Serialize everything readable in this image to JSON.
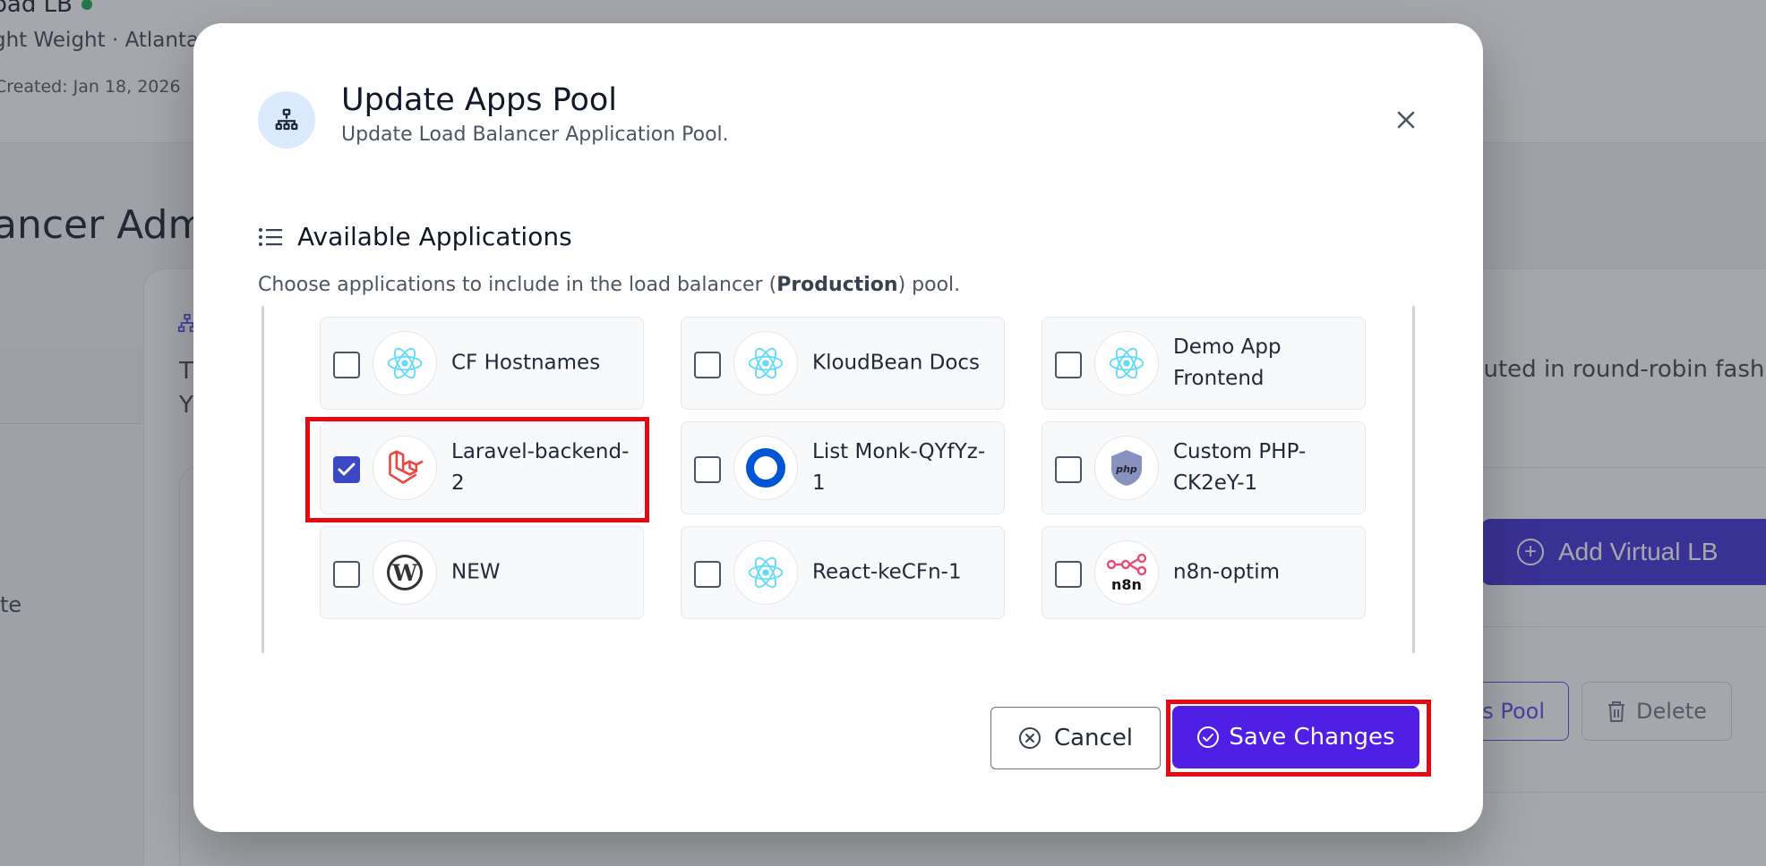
{
  "background": {
    "lb_name": "oad LB",
    "lb_meta": "ght Weight · Atlanta",
    "created": "Created: Jan 18, 2026",
    "page_title": "ancer Adm",
    "card_text_t": "T",
    "card_text_y": "Y",
    "side_text": "te",
    "round_robin_text": "buted in round-robin fash",
    "add_virtual_lb": "Add Virtual LB",
    "apps_pool_button": "s Pool",
    "delete_button": "Delete"
  },
  "modal": {
    "title": "Update Apps Pool",
    "subtitle": "Update Load Balancer Application Pool.",
    "section_title": "Available Applications",
    "desc_prefix": "Choose applications to include in the load balancer (",
    "desc_env": "Production",
    "desc_suffix": ") pool.",
    "cancel_label": "Cancel",
    "save_label": "Save Changes"
  },
  "apps": [
    {
      "name": "CF Hostnames",
      "icon": "react-icon",
      "checked": false
    },
    {
      "name": "KloudBean Docs",
      "icon": "react-icon",
      "checked": false
    },
    {
      "name": "Demo App Frontend",
      "icon": "react-icon",
      "checked": false
    },
    {
      "name": "Laravel-backend-2",
      "icon": "laravel-icon",
      "checked": true
    },
    {
      "name": "List Monk-QYfYz-1",
      "icon": "listmonk-icon",
      "checked": false
    },
    {
      "name": "Custom PHP-CK2eY-1",
      "icon": "php-icon",
      "checked": false
    },
    {
      "name": "NEW",
      "icon": "wordpress-icon",
      "checked": false
    },
    {
      "name": "React-keCFn-1",
      "icon": "react-icon",
      "checked": false
    },
    {
      "name": "n8n-optim",
      "icon": "n8n-icon",
      "checked": false
    }
  ],
  "colors": {
    "primary": "#4f1fe6",
    "checkbox_checked": "#3b48c4",
    "highlight": "#e50914",
    "status_online": "#16a34a"
  }
}
